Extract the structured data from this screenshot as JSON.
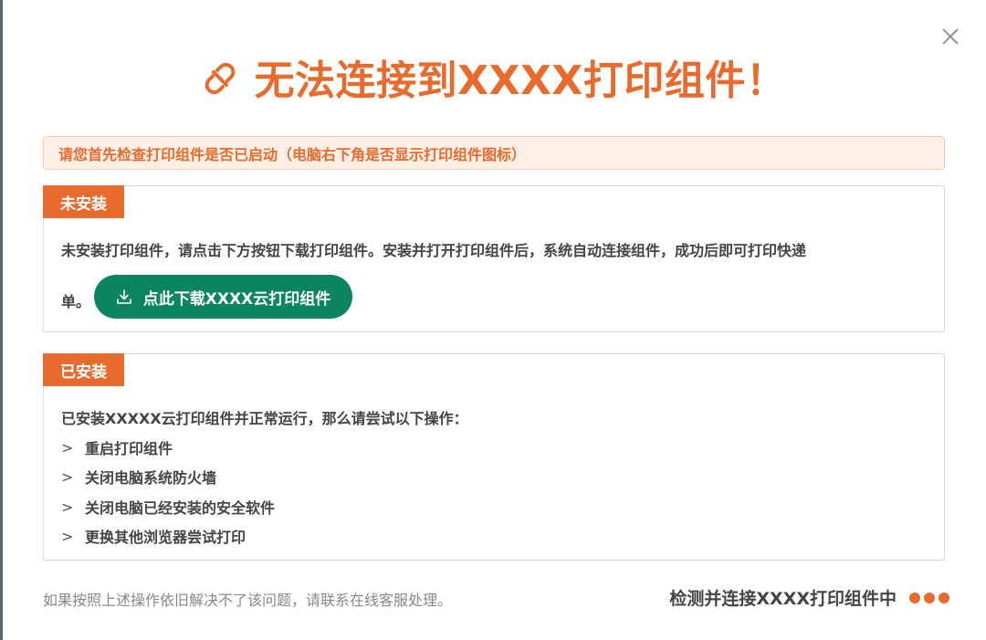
{
  "dialog": {
    "title": "无法连接到XXXX打印组件！",
    "notice": "请您首先检查打印组件是否已启动（电脑右下角是否显示打印组件图标）",
    "accent_color": "#e86b2d",
    "button_color": "#0b8460"
  },
  "not_installed": {
    "tag": "未安装",
    "line1": "未安装打印组件，请点击下方按钮下载打印组件。安装并打开打印组件后，系统自动连接组件，成功后即可打印快递",
    "line2": "单。",
    "download_button": "点此下载XXXX云打印组件"
  },
  "installed": {
    "tag": "已安装",
    "intro": "已安装XXXXX云打印组件并正常运行，那么请尝试以下操作：",
    "arrow_glyph": ">",
    "steps": [
      "重启打印组件",
      "关闭电脑系统防火墙",
      "关闭电脑已经安装的安全软件",
      "更换其他浏览器尝试打印"
    ]
  },
  "footer": {
    "note": "如果按照上述操作依旧解决不了该问题，请联系在线客服处理。",
    "status": "检测并连接XXXX打印组件中"
  },
  "icons": {
    "close": "close-icon",
    "title": "broken-link-icon",
    "download": "download-icon"
  }
}
